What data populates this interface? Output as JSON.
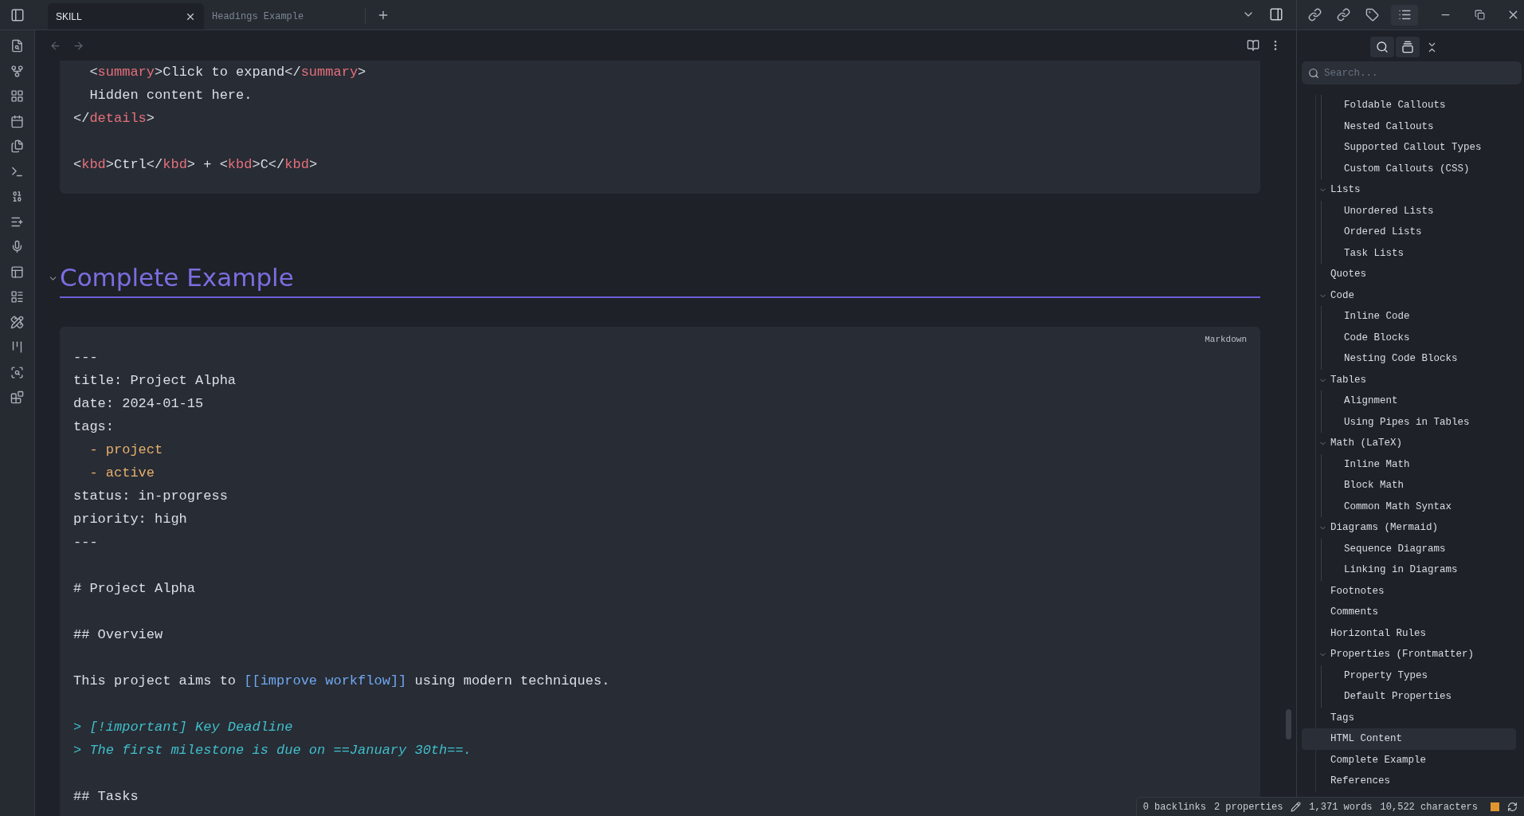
{
  "tabs": [
    {
      "label": "SKILL",
      "selected": true
    },
    {
      "label": "Headings Example",
      "selected": false
    }
  ],
  "editor": {
    "blocks": [
      {
        "kind": "code",
        "lines": [
          {
            "kind": "code",
            "segments": [
              {
                "text": "  <",
                "kind": "plain"
              },
              {
                "text": "summary",
                "kind": "tag"
              },
              {
                "text": ">Click to expand</",
                "kind": "plain"
              },
              {
                "text": "summary",
                "kind": "tag"
              },
              {
                "text": ">",
                "kind": "plain"
              }
            ]
          },
          {
            "kind": "code",
            "segments": [
              {
                "text": "  Hidden content here.",
                "kind": "plain"
              }
            ]
          },
          {
            "kind": "code",
            "segments": [
              {
                "text": "</",
                "kind": "plain"
              },
              {
                "text": "details",
                "kind": "tag"
              },
              {
                "text": ">",
                "kind": "plain"
              }
            ]
          },
          {
            "kind": "blank"
          },
          {
            "kind": "code",
            "segments": [
              {
                "text": "<",
                "kind": "plain"
              },
              {
                "text": "kbd",
                "kind": "tag"
              },
              {
                "text": ">Ctrl</",
                "kind": "plain"
              },
              {
                "text": "kbd",
                "kind": "tag"
              },
              {
                "text": "> + <",
                "kind": "plain"
              },
              {
                "text": "kbd",
                "kind": "tag"
              },
              {
                "text": ">C</",
                "kind": "plain"
              },
              {
                "text": "kbd",
                "kind": "tag"
              },
              {
                "text": ">",
                "kind": "plain"
              }
            ]
          }
        ]
      },
      {
        "kind": "heading",
        "text": "Complete Example",
        "expanded": true
      },
      {
        "kind": "code",
        "language": "Markdown",
        "lines": [
          {
            "kind": "code",
            "segments": [
              {
                "text": "---",
                "kind": "plain"
              }
            ]
          },
          {
            "kind": "code",
            "segments": [
              {
                "text": "title: Project Alpha",
                "kind": "plain"
              }
            ]
          },
          {
            "kind": "code",
            "segments": [
              {
                "text": "date: 2024-01-15",
                "kind": "plain"
              }
            ]
          },
          {
            "kind": "code",
            "segments": [
              {
                "text": "tags:",
                "kind": "plain"
              }
            ]
          },
          {
            "kind": "code",
            "segments": [
              {
                "text": "  - project",
                "kind": "item"
              }
            ]
          },
          {
            "kind": "code",
            "segments": [
              {
                "text": "  - active",
                "kind": "item"
              }
            ]
          },
          {
            "kind": "code",
            "segments": [
              {
                "text": "status: in-progress",
                "kind": "plain"
              }
            ]
          },
          {
            "kind": "code",
            "segments": [
              {
                "text": "priority: high",
                "kind": "plain"
              }
            ]
          },
          {
            "kind": "code",
            "segments": [
              {
                "text": "---",
                "kind": "plain"
              }
            ]
          },
          {
            "kind": "blank"
          },
          {
            "kind": "code",
            "segments": [
              {
                "text": "# Project Alpha",
                "kind": "plain"
              }
            ]
          },
          {
            "kind": "blank"
          },
          {
            "kind": "code",
            "segments": [
              {
                "text": "## Overview",
                "kind": "plain"
              }
            ]
          },
          {
            "kind": "blank"
          },
          {
            "kind": "code",
            "segments": [
              {
                "text": "This project aims to ",
                "kind": "plain"
              },
              {
                "text": "[[improve workflow]]",
                "kind": "link"
              },
              {
                "text": " using modern techniques.",
                "kind": "plain"
              }
            ]
          },
          {
            "kind": "blank"
          },
          {
            "kind": "code",
            "segments": [
              {
                "text": "> [!important] Key Deadline",
                "kind": "quote"
              }
            ]
          },
          {
            "kind": "code",
            "segments": [
              {
                "text": "> The first milestone is due on ==January 30th==.",
                "kind": "quote"
              }
            ]
          },
          {
            "kind": "blank"
          },
          {
            "kind": "code",
            "segments": [
              {
                "text": "## Tasks",
                "kind": "plain"
              }
            ]
          }
        ]
      }
    ]
  },
  "outline": {
    "search": {
      "placeholder": "Search..."
    },
    "items": [
      {
        "children": [
          {
            "label": "Foldable Callouts",
            "selected": false
          },
          {
            "label": "Nested Callouts",
            "selected": false
          },
          {
            "label": "Supported Callout Types",
            "selected": false
          },
          {
            "label": "Custom Callouts (CSS)",
            "selected": false
          }
        ]
      },
      {
        "label": "Lists",
        "selected": false,
        "expanded": true,
        "children": [
          {
            "label": "Unordered Lists",
            "selected": false
          },
          {
            "label": "Ordered Lists",
            "selected": false
          },
          {
            "label": "Task Lists",
            "selected": false
          }
        ]
      },
      {
        "label": "Quotes",
        "selected": false
      },
      {
        "label": "Code",
        "selected": false,
        "expanded": true,
        "children": [
          {
            "label": "Inline Code",
            "selected": false
          },
          {
            "label": "Code Blocks",
            "selected": false
          },
          {
            "label": "Nesting Code Blocks",
            "selected": false
          }
        ]
      },
      {
        "label": "Tables",
        "selected": false,
        "expanded": true,
        "children": [
          {
            "label": "Alignment",
            "selected": false
          },
          {
            "label": "Using Pipes in Tables",
            "selected": false
          }
        ]
      },
      {
        "label": "Math (LaTeX)",
        "selected": false,
        "expanded": true,
        "children": [
          {
            "label": "Inline Math",
            "selected": false
          },
          {
            "label": "Block Math",
            "selected": false
          },
          {
            "label": "Common Math Syntax",
            "selected": false
          }
        ]
      },
      {
        "label": "Diagrams (Mermaid)",
        "selected": false,
        "expanded": true,
        "children": [
          {
            "label": "Sequence Diagrams",
            "selected": false
          },
          {
            "label": "Linking in Diagrams",
            "selected": false
          }
        ]
      },
      {
        "label": "Footnotes",
        "selected": false
      },
      {
        "label": "Comments",
        "selected": false
      },
      {
        "label": "Horizontal Rules",
        "selected": false
      },
      {
        "label": "Properties (Frontmatter)",
        "selected": false,
        "expanded": true,
        "children": [
          {
            "label": "Property Types",
            "selected": false
          },
          {
            "label": "Default Properties",
            "selected": false
          }
        ]
      },
      {
        "label": "Tags",
        "selected": false
      },
      {
        "label": "HTML Content",
        "selected": true
      },
      {
        "label": "Complete Example",
        "selected": false
      },
      {
        "label": "References",
        "selected": false
      }
    ]
  },
  "status_bar": {
    "backlinks": "0 backlinks",
    "properties": "2 properties",
    "words": "1,371 words",
    "characters": "10,522 characters"
  }
}
